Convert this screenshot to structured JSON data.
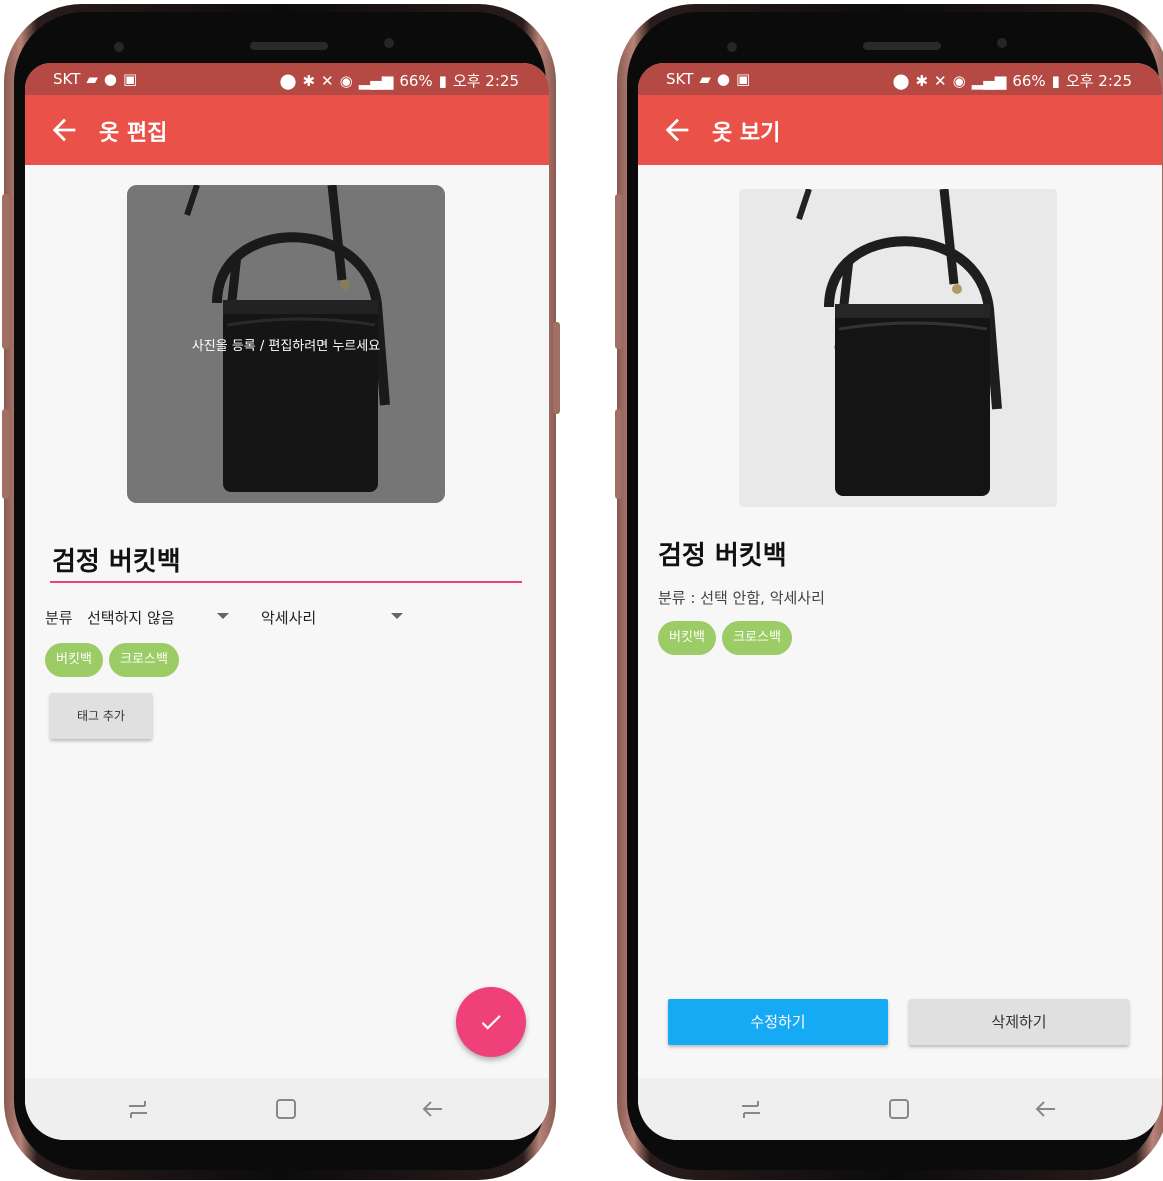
{
  "status_bar": {
    "carrier": "SKT",
    "battery": "66%",
    "time": "오후 2:25"
  },
  "edit_screen": {
    "title": "옷 편집",
    "photo_hint": "사진을 등록 / 편집하려면 누르세요",
    "name_value": "검정 버킷백",
    "category_label": "분류",
    "dropdown_1_value": "선택하지 않음",
    "dropdown_2_value": "악세사리",
    "tags": [
      "버킷백",
      "크로스백"
    ],
    "add_tag_button": "태그 추가",
    "accent_color": "#ea5149",
    "fab_color": "#ef407a"
  },
  "view_screen": {
    "title": "옷 보기",
    "name": "검정 버킷백",
    "category_text": "분류 : 선택 안함, 악세사리",
    "tags": [
      "버킷백",
      "크로스백"
    ],
    "edit_button": "수정하기",
    "delete_button": "삭제하기",
    "edit_button_color": "#16a9f4",
    "tag_color": "#9ccc65"
  },
  "icons": {
    "back": "arrow-left-icon",
    "fab": "check-icon",
    "nav": [
      "recent-apps-icon",
      "home-icon",
      "back-nav-icon"
    ]
  }
}
